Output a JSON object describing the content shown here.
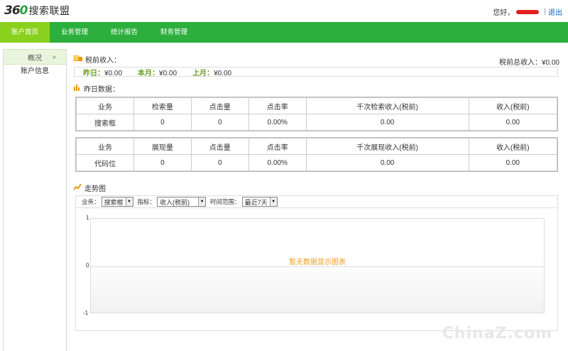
{
  "header": {
    "logo_num_a": "36",
    "logo_num_b": "0",
    "logo_text": "搜索联盟",
    "greeting": "您好，",
    "separator": "|",
    "logout": "退出"
  },
  "nav": {
    "items": [
      "账户首页",
      "业务管理",
      "统计报告",
      "财务管理"
    ],
    "active_index": 0
  },
  "sidebar": {
    "head": "概况",
    "chevron": "»",
    "items": [
      "账户信息"
    ]
  },
  "income": {
    "title": "税前收入：",
    "total": "税前总收入：¥0.00",
    "yesterday_label": "昨日：",
    "yesterday_value": "¥0.00",
    "month_label": "本月：",
    "month_value": "¥0.00",
    "last_month_label": "上月：",
    "last_month_value": "¥0.00"
  },
  "yesterday": {
    "title": "昨日数据："
  },
  "table1": {
    "headers": [
      "业务",
      "检索量",
      "点击量",
      "点击率",
      "千次检索收入(税前)",
      "收入(税前)"
    ],
    "row": [
      "搜索框",
      "0",
      "0",
      "0.00%",
      "0.00",
      "0.00"
    ]
  },
  "table2": {
    "headers": [
      "业务",
      "展现量",
      "点击量",
      "点击率",
      "千次展现收入(税前)",
      "收入(税前)"
    ],
    "row": [
      "代码位",
      "0",
      "0",
      "0.00%",
      "0.00",
      "0.00"
    ]
  },
  "trend": {
    "title": "走势图",
    "business_label": "业务：",
    "business_value": "搜索框",
    "metric_label": "指标：",
    "metric_value": "收入(税前)",
    "range_label": "时间范围：",
    "range_value": "最近7天",
    "y_ticks": [
      "1",
      "0",
      "-1"
    ],
    "no_data": "暂无数据显示图表"
  },
  "watermark": {
    "text": "ChinaZ.com"
  },
  "colors": {
    "nav": "#2caf3c",
    "nav_active": "#8ad11e",
    "income_label": "#6aa020",
    "no_data": "#f0a020"
  }
}
